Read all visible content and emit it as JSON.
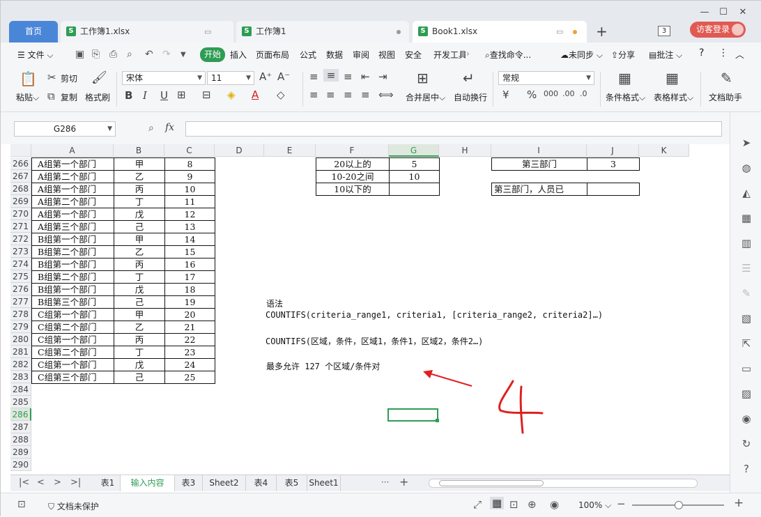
{
  "tabs": {
    "home": "首页",
    "docs": [
      {
        "name": "工作簿1.xlsx"
      },
      {
        "name": "工作簿1"
      },
      {
        "name": "Book1.xlsx"
      }
    ],
    "count": "3",
    "login": "访客登录"
  },
  "menu": {
    "file": "文件",
    "items": [
      "开始",
      "插入",
      "页面布局",
      "公式",
      "数据",
      "审阅",
      "视图",
      "安全",
      "开发工具"
    ],
    "search": "查找命令...",
    "sync": "未同步",
    "share": "分享",
    "comment": "批注"
  },
  "toolbar": {
    "paste": "粘贴",
    "cut": "剪切",
    "copy": "复制",
    "format_painter": "格式刷",
    "font_name": "宋体",
    "font_size": "11",
    "merge_center": "合并居中",
    "wrap_text": "自动换行",
    "number_format": "常规",
    "conditional_format": "条件格式",
    "table_style": "表格样式",
    "doc_helper": "文档助手"
  },
  "formula_bar": {
    "name_box": "G286",
    "fx_label": "fx",
    "content": ""
  },
  "grid": {
    "columns": [
      "A",
      "B",
      "C",
      "D",
      "E",
      "F",
      "G",
      "H",
      "I",
      "J",
      "K"
    ],
    "rows": [
      {
        "num": "266",
        "a": "A组第一个部门",
        "b": "甲",
        "c": "8"
      },
      {
        "num": "267",
        "a": "A组第二个部门",
        "b": "乙",
        "c": "9"
      },
      {
        "num": "268",
        "a": "A组第一个部门",
        "b": "丙",
        "c": "10"
      },
      {
        "num": "269",
        "a": "A组第二个部门",
        "b": "丁",
        "c": "11"
      },
      {
        "num": "270",
        "a": "A组第一个部门",
        "b": "戊",
        "c": "12"
      },
      {
        "num": "271",
        "a": "A组第三个部门",
        "b": "己",
        "c": "13"
      },
      {
        "num": "272",
        "a": "B组第一个部门",
        "b": "甲",
        "c": "14"
      },
      {
        "num": "273",
        "a": "B组第二个部门",
        "b": "乙",
        "c": "15"
      },
      {
        "num": "274",
        "a": "B组第一个部门",
        "b": "丙",
        "c": "16"
      },
      {
        "num": "275",
        "a": "B组第二个部门",
        "b": "丁",
        "c": "17"
      },
      {
        "num": "276",
        "a": "B组第一个部门",
        "b": "戊",
        "c": "18"
      },
      {
        "num": "277",
        "a": "B组第三个部门",
        "b": "己",
        "c": "19"
      },
      {
        "num": "278",
        "a": "C组第一个部门",
        "b": "甲",
        "c": "20"
      },
      {
        "num": "279",
        "a": "C组第二个部门",
        "b": "乙",
        "c": "21"
      },
      {
        "num": "280",
        "a": "C组第一个部门",
        "b": "丙",
        "c": "22"
      },
      {
        "num": "281",
        "a": "C组第二个部门",
        "b": "丁",
        "c": "23"
      },
      {
        "num": "282",
        "a": "C组第一个部门",
        "b": "戊",
        "c": "24"
      },
      {
        "num": "283",
        "a": "C组第三个部门",
        "b": "己",
        "c": "25"
      },
      {
        "num": "284",
        "a": "",
        "b": "",
        "c": ""
      },
      {
        "num": "285",
        "a": "",
        "b": "",
        "c": ""
      },
      {
        "num": "286",
        "a": "",
        "b": "",
        "c": ""
      },
      {
        "num": "287",
        "a": "",
        "b": "",
        "c": ""
      },
      {
        "num": "288",
        "a": "",
        "b": "",
        "c": ""
      },
      {
        "num": "289",
        "a": "",
        "b": "",
        "c": ""
      },
      {
        "num": "290",
        "a": "",
        "b": "",
        "c": ""
      }
    ],
    "f_table": [
      {
        "label": "20以上的",
        "value": "5"
      },
      {
        "label": "10-20之间",
        "value": "10"
      },
      {
        "label": "10以下的",
        "value": ""
      }
    ],
    "i_table": [
      {
        "label": "第三部门",
        "value": "3"
      },
      {
        "label": "第三部门，人员已",
        "value": ""
      }
    ],
    "notes": {
      "syntax_label": "语法",
      "syntax": "COUNTIFS(criteria_range1, criteria1, [criteria_range2, criteria2]…)",
      "syntax_cn": "COUNTIFS(区域，条件，区域1，条件1，区域2，条件2…)",
      "max_pairs": "最多允许 127 个区域/条件对"
    },
    "handwriting": "4"
  },
  "sheets": {
    "tabs": [
      "表1",
      "输入内容",
      "表3",
      "Sheet2",
      "表4",
      "表5",
      "Sheet1"
    ],
    "active_index": 1,
    "more": "···",
    "add": "+"
  },
  "status": {
    "protect": "文档未保护",
    "zoom": "100%"
  },
  "colors": {
    "accent_green": "#2e9c54",
    "home_tab_blue": "#4a86d8",
    "login_red": "#e05a53",
    "annotation_red": "#e02020"
  }
}
